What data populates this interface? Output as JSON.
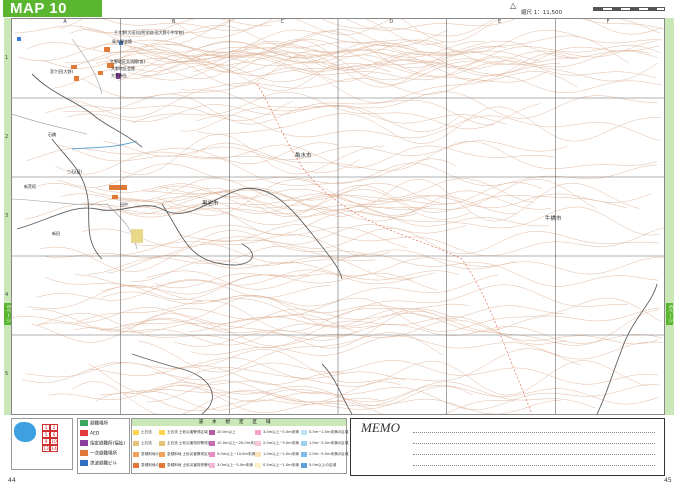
{
  "header": {
    "title": "MAP 10",
    "north_label": "N",
    "scale_label": "縮尺 1：11,500"
  },
  "grid": {
    "columns": [
      "A",
      "B",
      "C",
      "D",
      "E",
      "F"
    ],
    "rows": [
      "1",
      "2",
      "3",
      "4",
      "5"
    ]
  },
  "edge_tabs": {
    "left": "6ページ",
    "right": "6ページ"
  },
  "places": {
    "city1": "亀水市",
    "city2": "黒岩市",
    "city3": "牛橋市",
    "pois": [
      "千大野(大田)自然学校(旧大野小中学校)",
      "鳥大野会館",
      "大野地区交流館(仮)",
      "大野地区会館",
      "大野神社",
      "宮ケ田(大野)",
      "石橋",
      "三石(旧)",
      "田中",
      "新田",
      "新荒宿"
    ]
  },
  "legend": {
    "inset_cells": [
      "1",
      "2",
      "5",
      "6",
      "9",
      "10",
      "13",
      "14"
    ],
    "symbols": [
      "避難場所",
      "AED",
      "指定避難所(福祉)",
      "一次避難場所",
      "津波避難ビル"
    ],
    "table_title": "浸水想定区域",
    "table_cells": [
      "土石流",
      "土石流 土砂災害警戒区域",
      "20.0m以上",
      "3.0m以上~5.0m未満",
      "0.5m~1.0m未満の区域",
      "土石流",
      "土石流 土砂災害特別警戒区域",
      "10.0m以上~20.0m未満",
      "2.0m以上~3.0m未満",
      "1.0m~2.0m未満の区域",
      "急傾斜地の崩壊",
      "急傾斜地 土砂災害警戒区域",
      "5.0m以上~10.0m未満",
      "1.0m以上~2.0m未満",
      "2.0m~5.0m未満の区域",
      "急傾斜地の崩壊",
      "急傾斜地 土砂災害特別警戒区域",
      "3.0m以上~5.0m未満",
      "0.5m以上~1.0m未満",
      "5.0m以上の区域"
    ],
    "memo_title": "MEMO"
  },
  "pages": {
    "left": "44",
    "right": "45"
  },
  "colors": {
    "brand_green": "#5ab52f",
    "contour": "#d9a889",
    "river": "#5f5f5f",
    "sea": "#3da0e0"
  }
}
